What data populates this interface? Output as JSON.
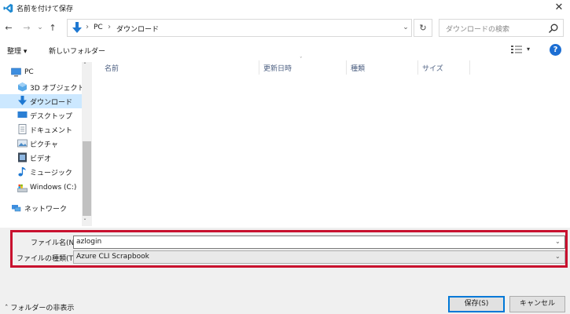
{
  "window": {
    "title": "名前を付けて保存",
    "close_glyph": "✕"
  },
  "nav": {
    "back_glyph": "←",
    "forward_glyph": "→",
    "recent_glyph": "⌄",
    "up_glyph": "↑",
    "breadcrumb": [
      "PC",
      "ダウンロード"
    ],
    "crumb_sep": "›",
    "dropdown_glyph": "⌄",
    "refresh_glyph": "↻"
  },
  "search": {
    "placeholder": "ダウンロードの検索"
  },
  "toolbar": {
    "organize_label": "整理 ▾",
    "new_folder_label": "新しいフォルダー",
    "view_chev": "▾",
    "help_label": "?"
  },
  "sidebar": {
    "items": [
      {
        "label": "PC",
        "icon": "pc-icon"
      },
      {
        "label": "3D オブジェクト",
        "icon": "3d-objects-icon"
      },
      {
        "label": "ダウンロード",
        "icon": "download-icon"
      },
      {
        "label": "デスクトップ",
        "icon": "desktop-icon"
      },
      {
        "label": "ドキュメント",
        "icon": "documents-icon"
      },
      {
        "label": "ピクチャ",
        "icon": "pictures-icon"
      },
      {
        "label": "ビデオ",
        "icon": "video-icon"
      },
      {
        "label": "ミュージック",
        "icon": "music-icon"
      },
      {
        "label": "Windows (C:)",
        "icon": "drive-icon"
      },
      {
        "label": "ネットワーク",
        "icon": "network-icon"
      }
    ],
    "scroll_up": "ˆ",
    "scroll_down": "ˇ"
  },
  "file_list": {
    "columns": [
      "名前",
      "更新日時",
      "種類",
      "サイズ"
    ],
    "sort_glyph": "ˇ"
  },
  "save_form": {
    "filename_label": "ファイル名(N):",
    "filename_value": "azlogin",
    "filetype_label": "ファイルの種類(T):",
    "filetype_value": "Azure CLI Scrapbook",
    "combo_glyph": "⌄"
  },
  "footer": {
    "hide_folders_label": "ˆ  フォルダーの非表示",
    "save_label": "保存(S)",
    "cancel_label": "キャンセル"
  },
  "colors": {
    "accent": "#0078d7",
    "selection": "#cce8ff",
    "highlight_box": "#c8102e",
    "help_blue": "#1c6ed3"
  }
}
